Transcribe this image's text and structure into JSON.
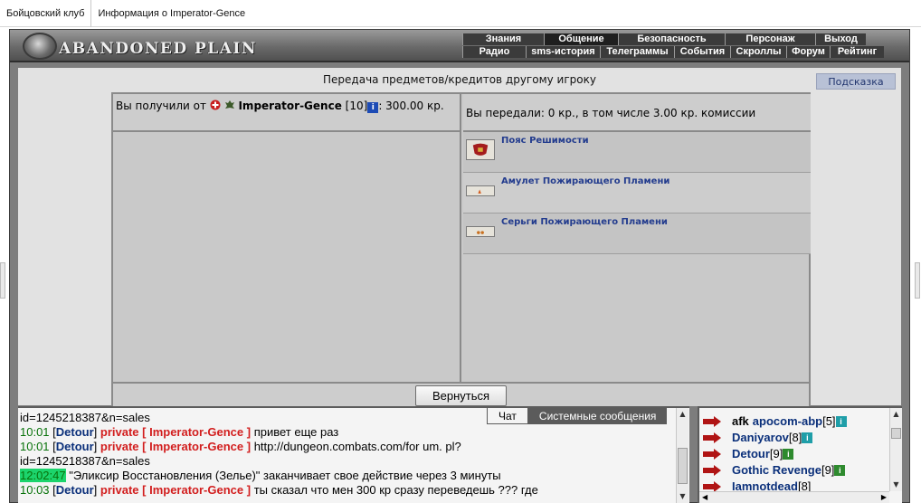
{
  "browser_tabs": [
    "Бойцовский клуб",
    "Информация о Imperator-Gence"
  ],
  "header": {
    "logo_text": "ABANDONED PLAIN",
    "menu_row1": [
      "Знания",
      "Общение",
      "Безопасность",
      "Персонаж",
      "Выход"
    ],
    "menu_row1_active": 1,
    "menu_row2": [
      "Радио",
      "sms-история",
      "Телеграммы",
      "События",
      "Скроллы",
      "Форум",
      "Рейтинг"
    ]
  },
  "page": {
    "title": "Передача предметов/кредитов другому игроку",
    "hint_label": "Подсказка"
  },
  "received": {
    "prefix": "Вы получили от",
    "player": "Imperator-Gence",
    "level": "[10]",
    "info_icon": "i",
    "amount": ": 300.00 кр."
  },
  "sent": {
    "summary": "Вы передали: 0 кр., в том числе 3.00 кр. комиссии",
    "items": [
      {
        "name": "Пояс Решимости",
        "icon": "belt-icon"
      },
      {
        "name": "Амулет Пожирающего Пламени",
        "icon": "amulet-icon"
      },
      {
        "name": "Серьги Пожирающего Пламени",
        "icon": "earrings-icon"
      }
    ]
  },
  "back_button": "Вернуться",
  "chat": {
    "tabs": [
      "Чат",
      "Системные сообщения"
    ],
    "lines": [
      {
        "text": "id=1245218387&n=sales"
      },
      {
        "time": "10:01",
        "nick": "Detour",
        "priv": "private [ Imperator-Gence ]",
        "text": "привет еще раз"
      },
      {
        "time": "10:01",
        "nick": "Detour",
        "priv": "private [ Imperator-Gence ]",
        "text": "http://dungeon.combats.com/for um. pl?"
      },
      {
        "text": "id=1245218387&n=sales"
      },
      {
        "time": "12:02:47",
        "time_highlight": true,
        "text": "\"Эликсир Восстановления (Зелье)\" заканчивает свое действие через 3 минуты"
      },
      {
        "time": "10:03",
        "nick": "Detour",
        "priv": "private [ Imperator-Gence ]",
        "text": "ты сказал что мен 300 кр сразу переведешь ??? где"
      }
    ]
  },
  "online": [
    {
      "afk": "afk",
      "name": "apocom-abp",
      "level": "[5]"
    },
    {
      "name": "Daniyarov",
      "level": "[8]"
    },
    {
      "name": "Detour",
      "level": "[9]"
    },
    {
      "name": "Gothic Revenge",
      "level": "[9]"
    },
    {
      "name": "Iamnotdead",
      "level": "[8]"
    }
  ],
  "colors": {
    "link_blue": "#233c8e",
    "private_red": "#d21e1e",
    "time_green": "#08720a",
    "time_highlight": "#1cd46c"
  }
}
